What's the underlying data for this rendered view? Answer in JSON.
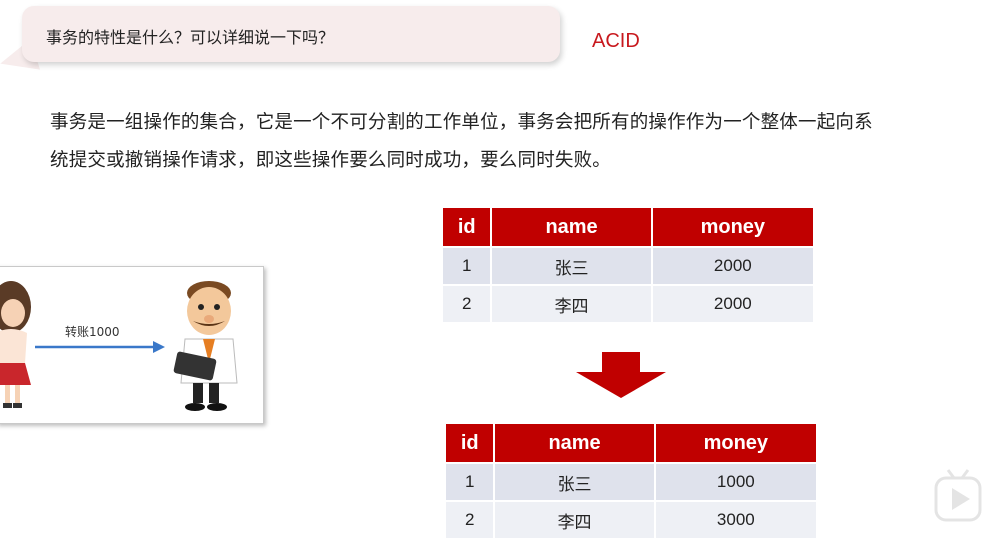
{
  "bubble": {
    "question": "事务的特性是什么？可以详细说一下吗？"
  },
  "acid_label": "ACID",
  "description": {
    "line1": "事务是一组操作的集合，它是一个不可分割的工作单位，事务会把所有的操作作为一个整体一起向系",
    "line2": "统提交或撤销操作请求，即这些操作要么同时成功，要么同时失败。"
  },
  "illustration": {
    "transfer_label": "转账1000"
  },
  "table_before": {
    "headers": [
      "id",
      "name",
      "money"
    ],
    "rows": [
      [
        "1",
        "张三",
        "2000"
      ],
      [
        "2",
        "李四",
        "2000"
      ]
    ]
  },
  "table_after": {
    "headers": [
      "id",
      "name",
      "money"
    ],
    "rows": [
      [
        "1",
        "张三",
        "1000"
      ],
      [
        "2",
        "李四",
        "3000"
      ]
    ]
  },
  "colors": {
    "accent_red": "#c00000",
    "acid_red": "#c8191e",
    "row_odd": "#dfe2ec",
    "row_even": "#eef0f5",
    "arrow_blue": "#3a78c9"
  },
  "icons": [
    "down-arrow-icon",
    "right-arrow-icon",
    "play-icon"
  ]
}
